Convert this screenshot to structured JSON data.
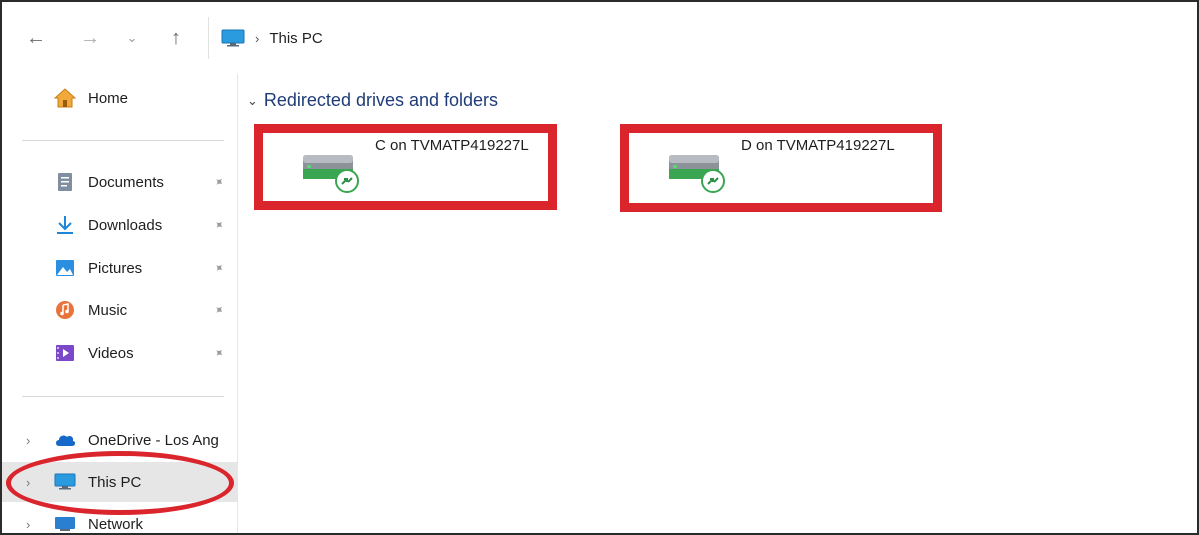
{
  "nav": {
    "back": "←",
    "forward": "→",
    "recent": "⌄",
    "up": "↑"
  },
  "address": {
    "separator": "›",
    "crumb": "This PC"
  },
  "sidebar": {
    "home": "Home",
    "quick_access": [
      {
        "label": "Documents"
      },
      {
        "label": "Downloads"
      },
      {
        "label": "Pictures"
      },
      {
        "label": "Music"
      },
      {
        "label": "Videos"
      }
    ],
    "locations": [
      {
        "label": "OneDrive - Los Ang"
      },
      {
        "label": "This PC"
      },
      {
        "label": "Network"
      }
    ]
  },
  "content": {
    "group_header": "Redirected drives and folders",
    "drives": [
      {
        "label": "C on TVMATP419227L"
      },
      {
        "label": "D on TVMATP419227L"
      }
    ]
  },
  "colors": {
    "highlight": "#d9252b",
    "group_header": "#1f3c78",
    "selected_bg": "#e6e6e6"
  }
}
